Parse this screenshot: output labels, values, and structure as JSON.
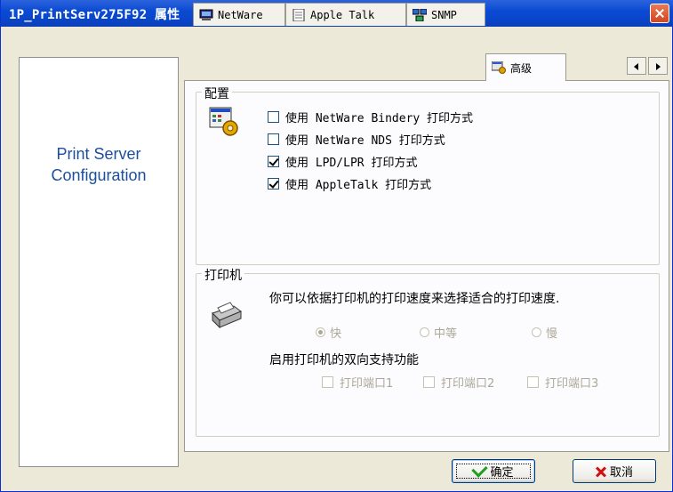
{
  "window": {
    "title": "1P_PrintServ275F92 属性"
  },
  "sidebar": {
    "brand_line1": "Print Server",
    "brand_line2": "Configuration"
  },
  "tabs": [
    {
      "label": "NetWare",
      "icon": "computer-icon"
    },
    {
      "label": "Apple Talk",
      "icon": "document-icon"
    },
    {
      "label": "SNMP",
      "icon": "network-icon"
    },
    {
      "label": "高级",
      "icon": "advanced-settings-icon",
      "active": true
    }
  ],
  "config_group": {
    "legend": "配置",
    "options": [
      {
        "label": "使用 NetWare Bindery 打印方式",
        "checked": false
      },
      {
        "label": "使用 NetWare NDS 打印方式",
        "checked": false
      },
      {
        "label": "使用 LPD/LPR 打印方式",
        "checked": true
      },
      {
        "label": "使用 AppleTalk 打印方式",
        "checked": true
      }
    ]
  },
  "printer_group": {
    "legend": "打印机",
    "speed_prompt": "你可以依据打印机的打印速度来选择适合的打印速度.",
    "speeds": [
      {
        "label": "快",
        "selected": true
      },
      {
        "label": "中等",
        "selected": false
      },
      {
        "label": "慢",
        "selected": false
      }
    ],
    "bidir_label": "启用打印机的双向支持功能",
    "ports": [
      {
        "label": "打印端口1",
        "checked": false
      },
      {
        "label": "打印端口2",
        "checked": false
      },
      {
        "label": "打印端口3",
        "checked": false
      }
    ]
  },
  "buttons": {
    "ok": "确定",
    "cancel": "取消"
  }
}
